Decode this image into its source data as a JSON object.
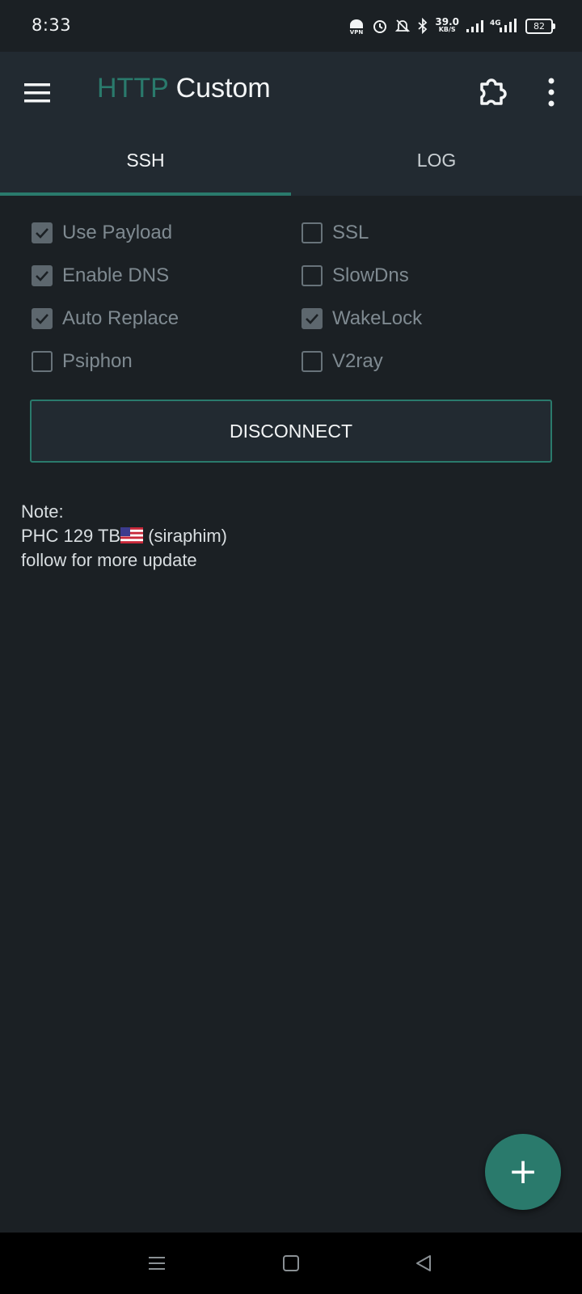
{
  "status_bar": {
    "time": "8:33",
    "speed_value": "39.0",
    "speed_unit": "KB/S",
    "network_label": "4G",
    "battery_level": "82",
    "icons": [
      "vpn-icon",
      "alarm-icon",
      "mute-bell-icon",
      "bluetooth-icon",
      "signal-icon",
      "signal-4g-icon",
      "battery-icon"
    ]
  },
  "app_bar": {
    "title_part1": "HTTP",
    "title_part2": "Custom",
    "icons": [
      "menu-icon",
      "plugin-icon",
      "more-vert-icon"
    ]
  },
  "tabs": [
    {
      "label": "SSH",
      "selected": true
    },
    {
      "label": "LOG",
      "selected": false
    }
  ],
  "options": [
    {
      "label": "Use Payload",
      "checked": true
    },
    {
      "label": "SSL",
      "checked": false
    },
    {
      "label": "Enable DNS",
      "checked": true
    },
    {
      "label": "SlowDns",
      "checked": false
    },
    {
      "label": "Auto Replace",
      "checked": true
    },
    {
      "label": "WakeLock",
      "checked": true
    },
    {
      "label": "Psiphon",
      "checked": false
    },
    {
      "label": "V2ray",
      "checked": false
    }
  ],
  "disconnect_label": "DISCONNECT",
  "note": {
    "line1": "Note:",
    "line2_a": "PHC 129 TB",
    "line2_b": " (siraphim)",
    "line3": "follow for more update"
  },
  "fab_label": "+",
  "nav_icons": [
    "recents-icon",
    "home-icon",
    "back-icon"
  ],
  "colors": {
    "accent": "#2a7a6c",
    "background": "#1b2024",
    "toolbar": "#222a31"
  }
}
